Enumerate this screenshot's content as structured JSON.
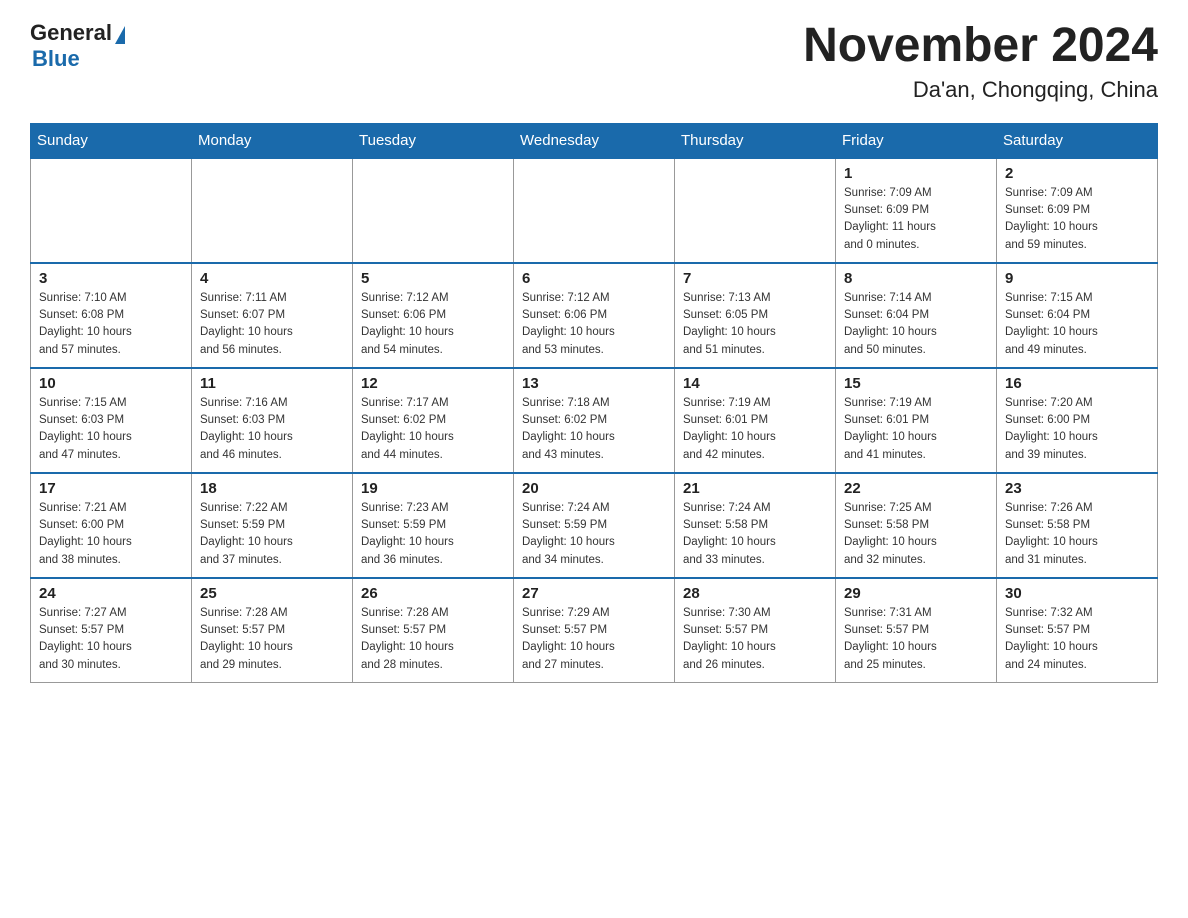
{
  "header": {
    "logo_general": "General",
    "logo_blue": "Blue",
    "month_title": "November 2024",
    "location": "Da'an, Chongqing, China"
  },
  "weekdays": [
    "Sunday",
    "Monday",
    "Tuesday",
    "Wednesday",
    "Thursday",
    "Friday",
    "Saturday"
  ],
  "weeks": [
    [
      {
        "day": "",
        "info": ""
      },
      {
        "day": "",
        "info": ""
      },
      {
        "day": "",
        "info": ""
      },
      {
        "day": "",
        "info": ""
      },
      {
        "day": "",
        "info": ""
      },
      {
        "day": "1",
        "info": "Sunrise: 7:09 AM\nSunset: 6:09 PM\nDaylight: 11 hours\nand 0 minutes."
      },
      {
        "day": "2",
        "info": "Sunrise: 7:09 AM\nSunset: 6:09 PM\nDaylight: 10 hours\nand 59 minutes."
      }
    ],
    [
      {
        "day": "3",
        "info": "Sunrise: 7:10 AM\nSunset: 6:08 PM\nDaylight: 10 hours\nand 57 minutes."
      },
      {
        "day": "4",
        "info": "Sunrise: 7:11 AM\nSunset: 6:07 PM\nDaylight: 10 hours\nand 56 minutes."
      },
      {
        "day": "5",
        "info": "Sunrise: 7:12 AM\nSunset: 6:06 PM\nDaylight: 10 hours\nand 54 minutes."
      },
      {
        "day": "6",
        "info": "Sunrise: 7:12 AM\nSunset: 6:06 PM\nDaylight: 10 hours\nand 53 minutes."
      },
      {
        "day": "7",
        "info": "Sunrise: 7:13 AM\nSunset: 6:05 PM\nDaylight: 10 hours\nand 51 minutes."
      },
      {
        "day": "8",
        "info": "Sunrise: 7:14 AM\nSunset: 6:04 PM\nDaylight: 10 hours\nand 50 minutes."
      },
      {
        "day": "9",
        "info": "Sunrise: 7:15 AM\nSunset: 6:04 PM\nDaylight: 10 hours\nand 49 minutes."
      }
    ],
    [
      {
        "day": "10",
        "info": "Sunrise: 7:15 AM\nSunset: 6:03 PM\nDaylight: 10 hours\nand 47 minutes."
      },
      {
        "day": "11",
        "info": "Sunrise: 7:16 AM\nSunset: 6:03 PM\nDaylight: 10 hours\nand 46 minutes."
      },
      {
        "day": "12",
        "info": "Sunrise: 7:17 AM\nSunset: 6:02 PM\nDaylight: 10 hours\nand 44 minutes."
      },
      {
        "day": "13",
        "info": "Sunrise: 7:18 AM\nSunset: 6:02 PM\nDaylight: 10 hours\nand 43 minutes."
      },
      {
        "day": "14",
        "info": "Sunrise: 7:19 AM\nSunset: 6:01 PM\nDaylight: 10 hours\nand 42 minutes."
      },
      {
        "day": "15",
        "info": "Sunrise: 7:19 AM\nSunset: 6:01 PM\nDaylight: 10 hours\nand 41 minutes."
      },
      {
        "day": "16",
        "info": "Sunrise: 7:20 AM\nSunset: 6:00 PM\nDaylight: 10 hours\nand 39 minutes."
      }
    ],
    [
      {
        "day": "17",
        "info": "Sunrise: 7:21 AM\nSunset: 6:00 PM\nDaylight: 10 hours\nand 38 minutes."
      },
      {
        "day": "18",
        "info": "Sunrise: 7:22 AM\nSunset: 5:59 PM\nDaylight: 10 hours\nand 37 minutes."
      },
      {
        "day": "19",
        "info": "Sunrise: 7:23 AM\nSunset: 5:59 PM\nDaylight: 10 hours\nand 36 minutes."
      },
      {
        "day": "20",
        "info": "Sunrise: 7:24 AM\nSunset: 5:59 PM\nDaylight: 10 hours\nand 34 minutes."
      },
      {
        "day": "21",
        "info": "Sunrise: 7:24 AM\nSunset: 5:58 PM\nDaylight: 10 hours\nand 33 minutes."
      },
      {
        "day": "22",
        "info": "Sunrise: 7:25 AM\nSunset: 5:58 PM\nDaylight: 10 hours\nand 32 minutes."
      },
      {
        "day": "23",
        "info": "Sunrise: 7:26 AM\nSunset: 5:58 PM\nDaylight: 10 hours\nand 31 minutes."
      }
    ],
    [
      {
        "day": "24",
        "info": "Sunrise: 7:27 AM\nSunset: 5:57 PM\nDaylight: 10 hours\nand 30 minutes."
      },
      {
        "day": "25",
        "info": "Sunrise: 7:28 AM\nSunset: 5:57 PM\nDaylight: 10 hours\nand 29 minutes."
      },
      {
        "day": "26",
        "info": "Sunrise: 7:28 AM\nSunset: 5:57 PM\nDaylight: 10 hours\nand 28 minutes."
      },
      {
        "day": "27",
        "info": "Sunrise: 7:29 AM\nSunset: 5:57 PM\nDaylight: 10 hours\nand 27 minutes."
      },
      {
        "day": "28",
        "info": "Sunrise: 7:30 AM\nSunset: 5:57 PM\nDaylight: 10 hours\nand 26 minutes."
      },
      {
        "day": "29",
        "info": "Sunrise: 7:31 AM\nSunset: 5:57 PM\nDaylight: 10 hours\nand 25 minutes."
      },
      {
        "day": "30",
        "info": "Sunrise: 7:32 AM\nSunset: 5:57 PM\nDaylight: 10 hours\nand 24 minutes."
      }
    ]
  ]
}
